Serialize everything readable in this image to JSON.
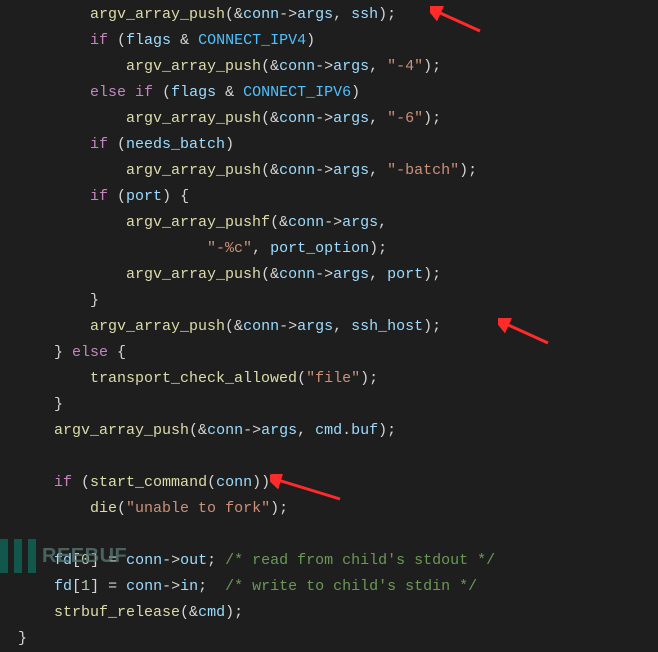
{
  "code": {
    "l1_fn": "argv_array_push",
    "l1_arg1": "conn",
    "l1_member": "args",
    "l1_arg2": "ssh",
    "l2_kw": "if",
    "l2_var": "flags",
    "l2_const": "CONNECT_IPV4",
    "l3_fn": "argv_array_push",
    "l3_arg1": "conn",
    "l3_member": "args",
    "l3_str": "\"-4\"",
    "l4_kw1": "else",
    "l4_kw2": "if",
    "l4_var": "flags",
    "l4_const": "CONNECT_IPV6",
    "l5_fn": "argv_array_push",
    "l5_arg1": "conn",
    "l5_member": "args",
    "l5_str": "\"-6\"",
    "l6_kw": "if",
    "l6_var": "needs_batch",
    "l7_fn": "argv_array_push",
    "l7_arg1": "conn",
    "l7_member": "args",
    "l7_str": "\"-batch\"",
    "l8_kw": "if",
    "l8_var": "port",
    "l9_fn": "argv_array_pushf",
    "l9_arg1": "conn",
    "l9_member": "args",
    "l10_str": "\"-%c\"",
    "l10_var": "port_option",
    "l11_fn": "argv_array_push",
    "l11_arg1": "conn",
    "l11_member": "args",
    "l11_var": "port",
    "l13_fn": "argv_array_push",
    "l13_arg1": "conn",
    "l13_member": "args",
    "l13_var": "ssh_host",
    "l14_kw": "else",
    "l15_fn": "transport_check_allowed",
    "l15_str": "\"file\"",
    "l17_fn": "argv_array_push",
    "l17_arg1": "conn",
    "l17_member": "args",
    "l17_var1": "cmd",
    "l17_var2": "buf",
    "l19_kw": "if",
    "l19_fn": "start_command",
    "l19_var": "conn",
    "l20_fn": "die",
    "l20_str": "\"unable to fork\"",
    "l22_var1": "fd",
    "l22_idx": "0",
    "l22_var2": "conn",
    "l22_member": "out",
    "l22_comment": "/* read from child's stdout */",
    "l23_var1": "fd",
    "l23_idx": "1",
    "l23_var2": "conn",
    "l23_member": "in",
    "l23_comment": "/* write to child's stdin */",
    "l24_fn": "strbuf_release",
    "l24_var": "cmd"
  },
  "watermark": "REEBUF"
}
